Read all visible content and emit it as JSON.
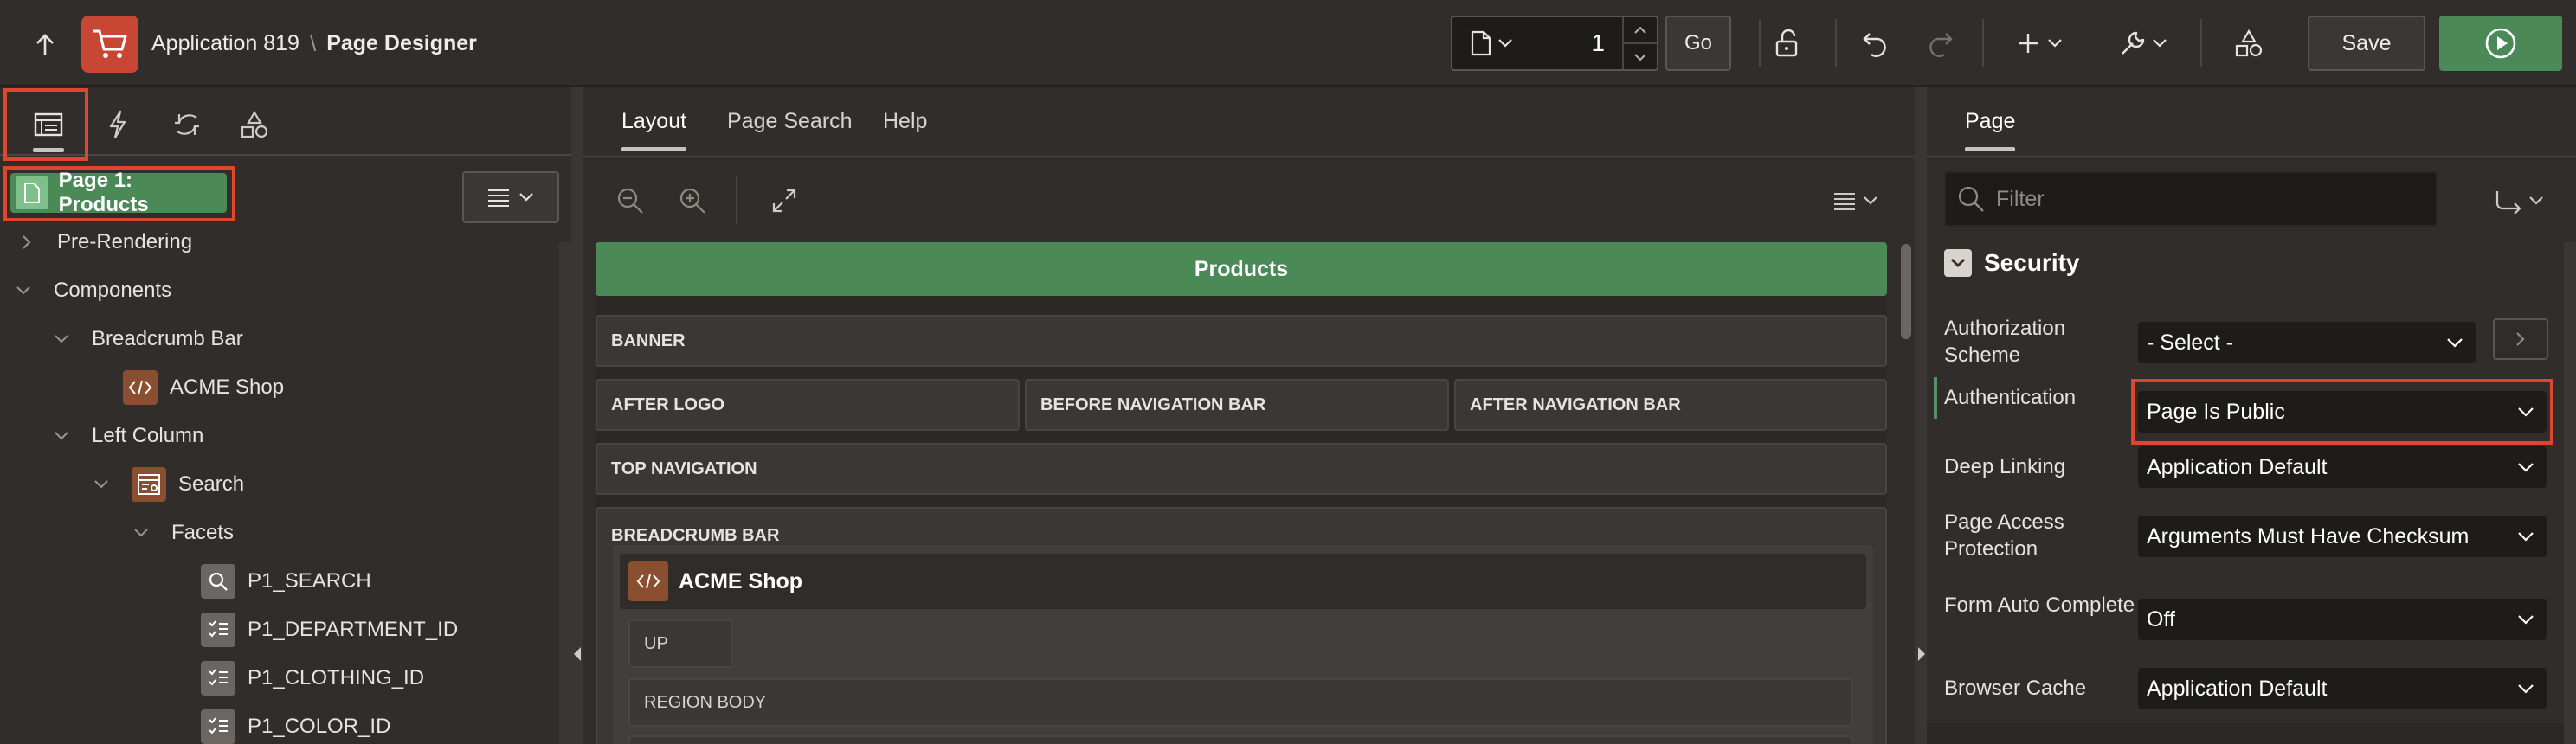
{
  "header": {
    "app_name": "Application 819",
    "separator": "\\",
    "page_designer": "Page Designer",
    "page_number": "1",
    "go_label": "Go",
    "save_label": "Save"
  },
  "left": {
    "page_chip": "Page 1: Products",
    "tree": [
      {
        "label": "Pre-Rendering"
      },
      {
        "label": "Components"
      },
      {
        "label": "Breadcrumb Bar"
      },
      {
        "label": "ACME Shop"
      },
      {
        "label": "Left Column"
      },
      {
        "label": "Search"
      },
      {
        "label": "Facets"
      },
      {
        "label": "P1_SEARCH"
      },
      {
        "label": "P1_DEPARTMENT_ID"
      },
      {
        "label": "P1_CLOTHING_ID"
      },
      {
        "label": "P1_COLOR_ID"
      }
    ]
  },
  "center": {
    "tabs": [
      {
        "label": "Layout"
      },
      {
        "label": "Page Search"
      },
      {
        "label": "Help"
      }
    ],
    "products": "Products",
    "slots": {
      "banner": "BANNER",
      "after_logo": "AFTER LOGO",
      "before_nav": "BEFORE NAVIGATION BAR",
      "after_nav": "AFTER NAVIGATION BAR",
      "top_nav": "TOP NAVIGATION",
      "breadcrumb_bar": "BREADCRUMB BAR",
      "acme": "ACME Shop",
      "up": "UP",
      "region_body": "REGION BODY"
    }
  },
  "right": {
    "tab": "Page",
    "filter_placeholder": "Filter",
    "section": "Security",
    "props": [
      {
        "label": "Authorization Scheme",
        "value": "- Select -"
      },
      {
        "label": "Authentication",
        "value": "Page Is Public"
      },
      {
        "label": "Deep Linking",
        "value": "Application Default"
      },
      {
        "label": "Page Access Protection",
        "value": "Arguments Must Have Checksum"
      },
      {
        "label": "Form Auto Complete",
        "value": "Off"
      },
      {
        "label": "Browser Cache",
        "value": "Application Default"
      }
    ]
  },
  "colors": {
    "accent_green": "#4b8a57",
    "highlight_red": "#e0452e",
    "logo_red": "#c74634",
    "background": "#312d2a"
  }
}
